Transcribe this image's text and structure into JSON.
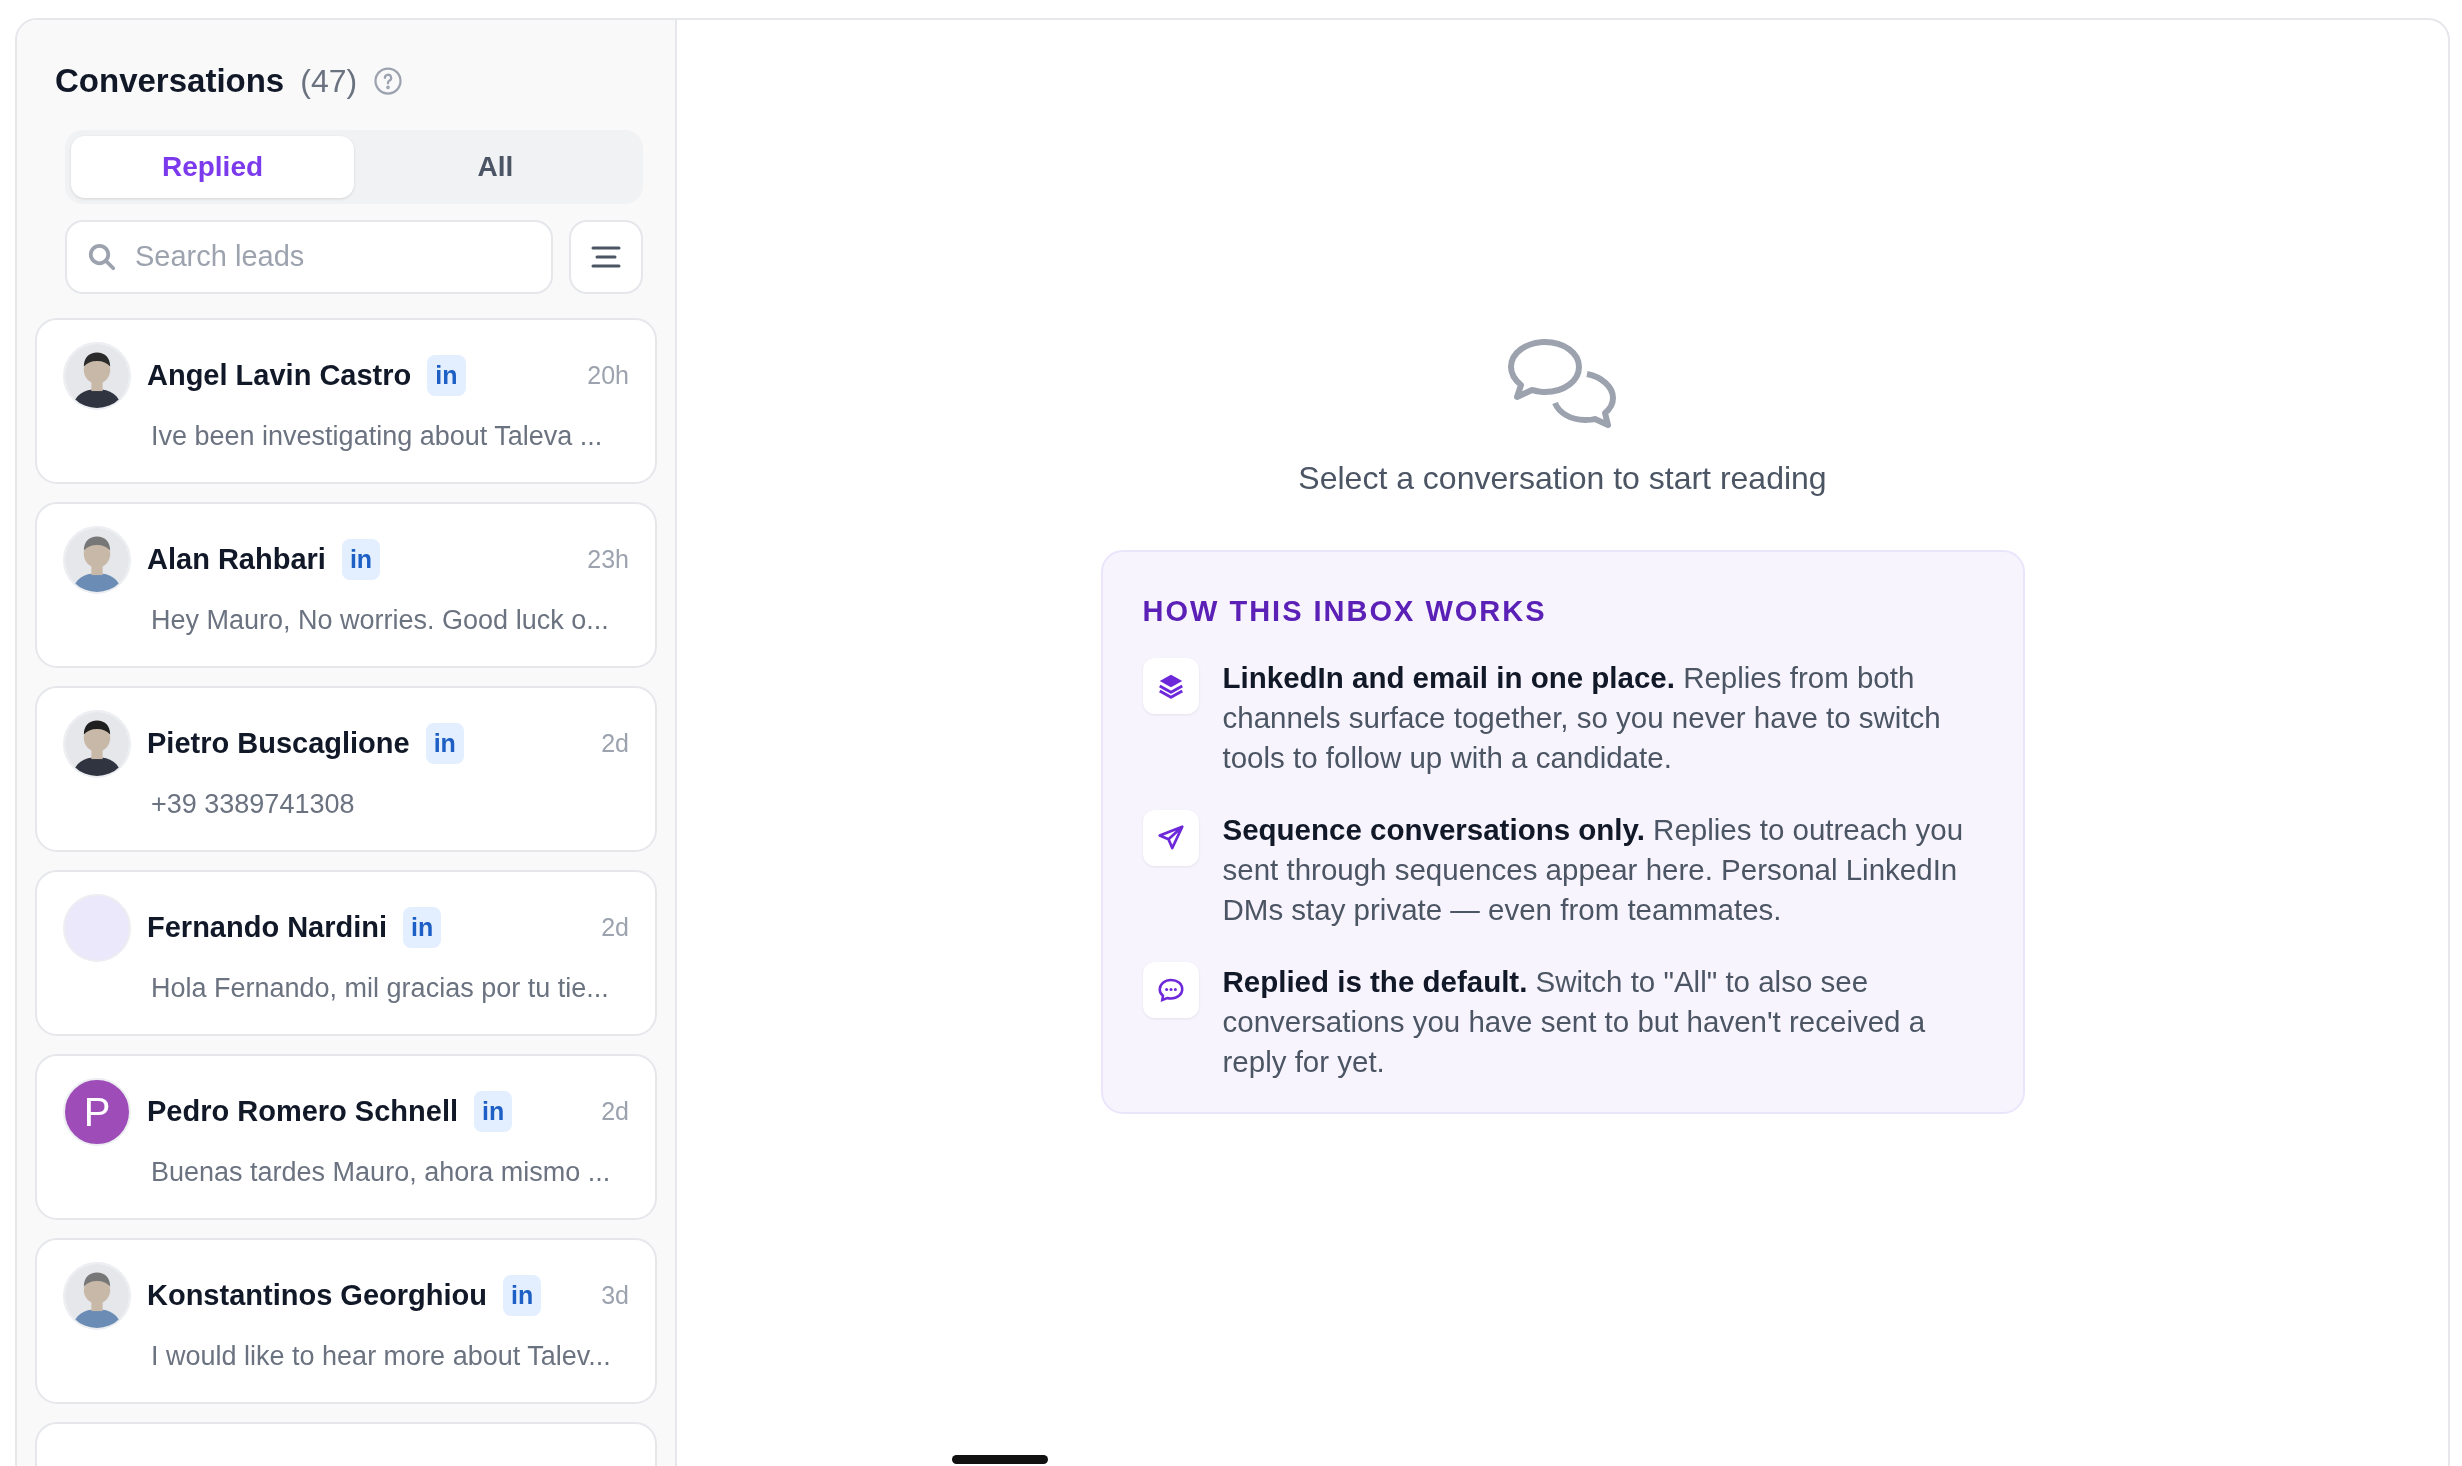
{
  "sidebar": {
    "title": "Conversations",
    "count": "(47)",
    "tabs": [
      {
        "label": "Replied",
        "selected": true
      },
      {
        "label": "All",
        "selected": false
      }
    ],
    "search": {
      "placeholder": "Search leads"
    },
    "conversations": [
      {
        "name": "Angel Lavin Castro",
        "channel": "in",
        "time": "20h",
        "preview": "Ive been investigating about Taleva ..."
      },
      {
        "name": "Alan Rahbari",
        "channel": "in",
        "time": "23h",
        "preview": "Hey Mauro, No worries. Good luck o..."
      },
      {
        "name": "Pietro Buscaglione",
        "channel": "in",
        "time": "2d",
        "preview": "+39 3389741308"
      },
      {
        "name": "Fernando Nardini",
        "channel": "in",
        "time": "2d",
        "preview": "Hola Fernando, mil gracias por tu tie...",
        "avatar": {
          "kind": "blank",
          "color": "#ece8fb"
        }
      },
      {
        "name": "Pedro Romero Schnell",
        "channel": "in",
        "time": "2d",
        "preview": "Buenas tardes Mauro, ahora mismo ...",
        "avatar": {
          "kind": "letter",
          "letter": "P",
          "color": "#9d4cb8"
        }
      },
      {
        "name": "Konstantinos Georghiou",
        "channel": "in",
        "time": "3d",
        "preview": "I would like to hear more about Talev..."
      }
    ]
  },
  "main": {
    "empty_message": "Select a conversation to start reading",
    "info": {
      "heading": "HOW THIS INBOX WORKS",
      "items": [
        {
          "kind": "layers",
          "text": "**LinkedIn and email in one place.** Replies from both channels surface together, so you never have to switch tools to follow up with a candidate."
        },
        {
          "kind": "send",
          "text": "**Sequence conversations only.** Replies to outreach you sent through sequences appear here. Personal LinkedIn DMs stay private — even from teammates."
        },
        {
          "kind": "chat",
          "text": "**Replied is the default.** Switch to \"All\" to also see conversations you have sent to but haven't received a reply for yet."
        }
      ]
    }
  }
}
